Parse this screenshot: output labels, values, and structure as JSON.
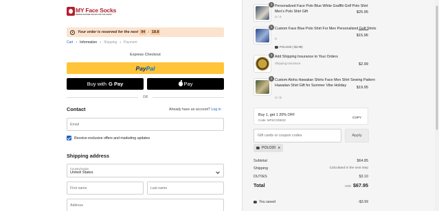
{
  "brand": {
    "name": "MY Face Socks",
    "tagline": "DESIGN SUPERB SOCKS FOR THE FAMILY"
  },
  "reservation": {
    "text": "Your order is reserved for the next",
    "minutes": "04",
    "seconds": "18.8"
  },
  "breadcrumb": {
    "cart": "Cart",
    "information": "Information",
    "shipping": "Shipping",
    "payment": "Payment"
  },
  "express": {
    "label": "Express Checkout",
    "paypal_pay": "Pay",
    "paypal_pal": "Pal",
    "gpay": "Buy with",
    "gpay_brand": "G Pay",
    "applepay": "Pay",
    "or": "OR"
  },
  "contact": {
    "heading": "Contact",
    "have_account": "Already have an account?",
    "login": "Log in",
    "email_placeholder": "Email",
    "marketing": "Receive exclusive offers and marketing updates"
  },
  "shipping": {
    "heading": "Shipping address",
    "country_label": "Country/region",
    "country_value": "United States",
    "first_name": "First name",
    "last_name": "Last name",
    "address": "Address"
  },
  "cart": {
    "items": [
      {
        "qty": "1",
        "title": "Personalized Face Polo Blue White Graffiti Golf Polo Shirt Men's Polo Shirt Gift",
        "variant": "S / S",
        "price": "$25.95",
        "colors": [
          "#3b4f6b",
          "#d8d2c4"
        ]
      },
      {
        "qty": "1",
        "title": "Custom Face Blue Polo Shirt For Men Personalized Golf Shirts",
        "variant": "S",
        "discount": "POLO20 (-$3.99)",
        "old_price": "$19.95",
        "price": "$15.96",
        "colors": [
          "#2d4a8a",
          "#9ab0d6"
        ]
      },
      {
        "qty": "1",
        "title": "Add Shipping Insurance to Your Orders",
        "variant": "Shipping Insurance",
        "price": "$2.99",
        "colors": [
          "#caa23a",
          "#222222"
        ]
      },
      {
        "qty": "1",
        "title": "Custom Aloha Hawaiian Shirts Face Men Shirt Sewing Pattern Hawaiian Shirt Gift for Summer Vibe Holiday",
        "variant": "S / D",
        "price": "$19.95",
        "colors": [
          "#4a5a3a",
          "#c8b88a"
        ]
      }
    ],
    "promo": {
      "title": "Buy 1, get 1 20% OFF",
      "code": "Code: MFSCODE20",
      "copy": "COPY"
    },
    "gift_placeholder": "Gift cards or coupon codes",
    "apply": "Apply",
    "applied_code": "POLO20",
    "subtotal_label": "Subtotal",
    "subtotal": "$64.85",
    "shipping_label": "Shipping",
    "shipping": "Calculated in the next step",
    "duties_label": "DUTIES",
    "duties": "$3.10",
    "total_label": "Total",
    "total_currency": "USD",
    "total": "$67.95",
    "saved_label": "You saved",
    "saved": "-$3.99"
  }
}
